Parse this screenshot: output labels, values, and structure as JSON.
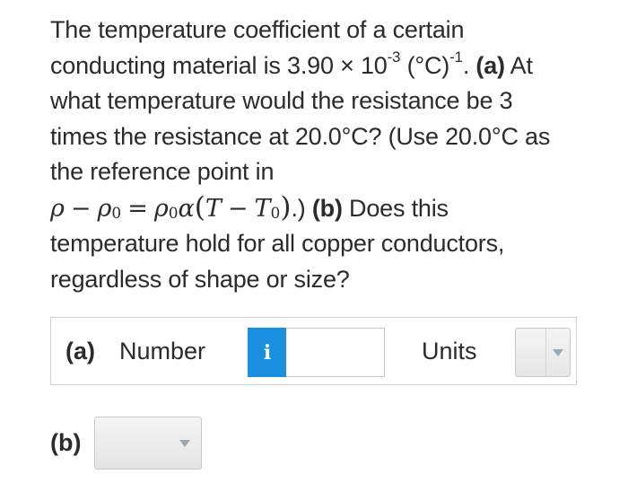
{
  "question": {
    "line1": "The temperature coefficient of a certain",
    "line2_pre": "conducting material is 3.90 × 10",
    "line2_exp1": "-3",
    "line2_mid": " (°C)",
    "line2_exp2": "-1",
    "line2_dot": ". ",
    "line2_part_a": "(a)",
    "line2_post": " At",
    "line3": "what temperature would the resistance be 3",
    "line4": "times the resistance at 20.0°C? (Use 20.0°C as",
    "line5": "the reference point in",
    "formula": {
      "rho": "ρ",
      "minus": "−",
      "rho0": "ρ",
      "sub0": "0",
      "equals": "=",
      "rho0b": "ρ",
      "sub0b": "0",
      "alpha": "α",
      "lparen": "(",
      "T": "T",
      "minus2": "−",
      "T0": "T",
      "subT0": "0",
      "rparen": ")"
    },
    "line6_after_formula": ".)",
    "line6_part_b": " (b)",
    "line6_post": " Does this",
    "line7": "temperature hold for all copper conductors,",
    "line8": "regardless of shape or size?"
  },
  "part_a": {
    "label": "(a)",
    "number_label": "Number",
    "info_button": "i",
    "number_value": "",
    "units_label": "Units",
    "units_value": ""
  },
  "part_b": {
    "label": "(b)",
    "select_value": ""
  },
  "colors": {
    "info_button": "#1a8fe0",
    "text": "#2b2b2b",
    "border": "#d0d0d0"
  }
}
